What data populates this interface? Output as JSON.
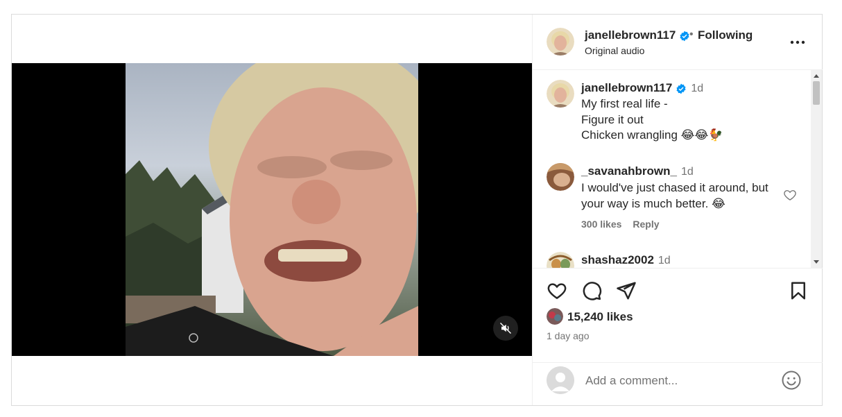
{
  "post": {
    "username": "janellebrown117",
    "following_label": "Following",
    "separator": "•",
    "audio_label": "Original audio",
    "more_label": "•••"
  },
  "caption": {
    "username": "janellebrown117",
    "time": "1d",
    "lines": "My first real life -\nFigure it out\nChicken wrangling 😂😂🐓"
  },
  "comments": [
    {
      "username": "_savanahbrown_",
      "time": "1d",
      "text": "I would've just chased it around, but your way is much better. 😂",
      "likes": "300 likes",
      "reply": "Reply"
    },
    {
      "username": "shashaz2002",
      "time": "1d"
    }
  ],
  "actions": {
    "likes": "15,240 likes",
    "posted": "1 day ago"
  },
  "add_comment": {
    "placeholder": "Add a comment..."
  },
  "colors": {
    "verified": "#0095f6",
    "muted_text": "#737373",
    "border": "#dbdbdb"
  }
}
